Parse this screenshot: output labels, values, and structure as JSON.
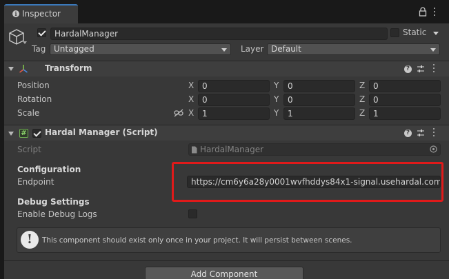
{
  "tab": {
    "title": "Inspector"
  },
  "object": {
    "name": "HardalManager",
    "static_label": "Static",
    "tag_label": "Tag",
    "tag_value": "Untagged",
    "layer_label": "Layer",
    "layer_value": "Default"
  },
  "transform": {
    "title": "Transform",
    "rows": [
      {
        "label": "Position",
        "x": "0",
        "y": "0",
        "z": "0"
      },
      {
        "label": "Rotation",
        "x": "0",
        "y": "0",
        "z": "0"
      },
      {
        "label": "Scale",
        "x": "1",
        "y": "1",
        "z": "1"
      }
    ],
    "axis_x": "X",
    "axis_y": "Y",
    "axis_z": "Z"
  },
  "script_component": {
    "title": "Hardal Manager (Script)",
    "script_label": "Script",
    "script_value": "HardalManager",
    "config_heading": "Configuration",
    "endpoint_label": "Endpoint",
    "endpoint_value": "https://cm6y6a28y0001wvfhddys84x1-signal.usehardal.com",
    "debug_heading": "Debug Settings",
    "debug_label": "Enable Debug Logs",
    "help_text": "This component should exist only once in your project. It will persist between scenes.",
    "help_icon_char": "!"
  },
  "add_component_label": "Add Component",
  "colors": {
    "accent_tab": "#3a79bb",
    "highlight": "#e01a1a"
  }
}
